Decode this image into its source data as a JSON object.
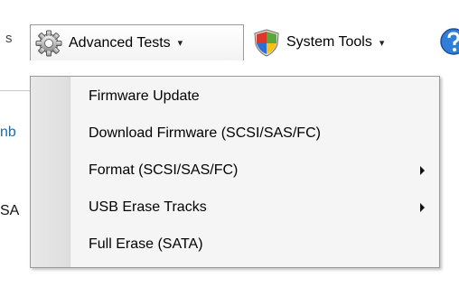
{
  "toolbar": {
    "partial_left_text": "s",
    "advanced_tests": {
      "label": "Advanced Tests",
      "icon": "gear-icon",
      "caret": "▾"
    },
    "system_tools": {
      "label": "System Tools",
      "icon": "shield-icon",
      "caret": "▾"
    },
    "edge_icon": "help-icon"
  },
  "background": {
    "partial_text_1": "nb",
    "partial_text_2": "SA"
  },
  "menu": {
    "items": [
      {
        "label": "Firmware Update",
        "submenu": false
      },
      {
        "label": "Download Firmware (SCSI/SAS/FC)",
        "submenu": false
      },
      {
        "label": "Format (SCSI/SAS/FC)",
        "submenu": true
      },
      {
        "label": "USB Erase Tracks",
        "submenu": true
      },
      {
        "label": "Full Erase (SATA)",
        "submenu": false
      }
    ]
  }
}
